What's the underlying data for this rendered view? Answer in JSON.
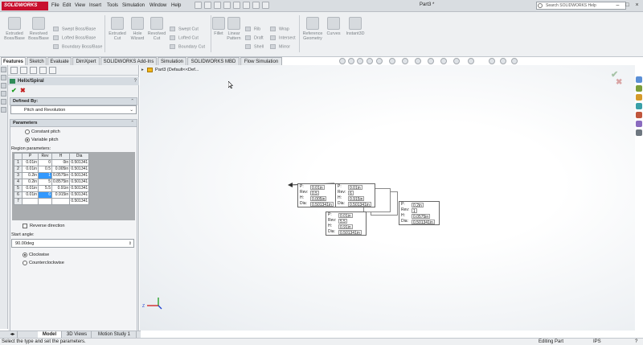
{
  "app": {
    "logo": "SOLIDWORKS",
    "document_title": "Part3 *",
    "help_search_placeholder": "Search SOLIDWORKS Help"
  },
  "menus": [
    "File",
    "Edit",
    "View",
    "Insert",
    "Tools",
    "Simulation",
    "Window",
    "Help"
  ],
  "ribbon": {
    "extruded_boss": "Extruded Boss/Base",
    "revolved_boss": "Revolved Boss/Base",
    "swept_boss": "Swept Boss/Base",
    "lofted_boss": "Lofted Boss/Base",
    "boundary_boss": "Boundary Boss/Base",
    "extruded_cut": "Extruded Cut",
    "hole_wizard": "Hole Wizard",
    "revolved_cut": "Revolved Cut",
    "swept_cut": "Swept Cut",
    "lofted_cut": "Lofted Cut",
    "boundary_cut": "Boundary Cut",
    "fillet": "Fillet",
    "linear_pattern": "Linear Pattern",
    "rib": "Rib",
    "draft": "Draft",
    "shell": "Shell",
    "wrap": "Wrap",
    "intersect": "Intersect",
    "mirror": "Mirror",
    "reference_geometry": "Reference Geometry",
    "curves": "Curves",
    "instant3d": "Instant3D"
  },
  "command_tabs": [
    "Features",
    "Sketch",
    "Evaluate",
    "DimXpert",
    "SOLIDWORKS Add-Ins",
    "Simulation",
    "SOLIDWORKS MBD",
    "Flow Simulation"
  ],
  "property_manager": {
    "title": "Helix/Spiral",
    "help_icon": "?",
    "defined_by": {
      "header": "Defined By:",
      "selected": "Pitch and Revolution"
    },
    "parameters": {
      "header": "Parameters",
      "constant_pitch": "Constant pitch",
      "variable_pitch": "Variable pitch",
      "variable_pitch_selected": true,
      "region_label": "Region parameters:",
      "columns": [
        "P",
        "Rev",
        "H",
        "Dia"
      ],
      "rows": [
        {
          "n": "1",
          "p": "0.01in",
          "rev": "0",
          "h": "0in",
          "dia": "0.501341"
        },
        {
          "n": "2",
          "p": "0.01in",
          "rev": "0.5",
          "h": "0.005in",
          "dia": "0.501341"
        },
        {
          "n": "3",
          "p": "0.2in",
          "rev": "1",
          "h": "0.0575in",
          "dia": "0.501341"
        },
        {
          "n": "4",
          "p": "0.2in",
          "rev": "5",
          "h": "0.8575in",
          "dia": "0.501341"
        },
        {
          "n": "5",
          "p": "0.01in",
          "rev": "5.5",
          "h": "0.91in",
          "dia": "0.501341"
        },
        {
          "n": "6",
          "p": "0.01in",
          "rev": "6",
          "h": "0.915in",
          "dia": "0.501341"
        },
        {
          "n": "7",
          "p": "",
          "rev": "",
          "h": "",
          "dia": "0.501341"
        }
      ],
      "reverse_direction": "Reverse direction",
      "start_angle_label": "Start angle:",
      "start_angle_value": "90.00deg",
      "clockwise": "Clockwise",
      "counterclockwise": "Counterclockwise",
      "clockwise_selected": true
    }
  },
  "tree": {
    "root": "Part3  (Default<<Def..."
  },
  "callouts": [
    {
      "p": "0.01in",
      "rev": "0.5",
      "h": "0.005in",
      "dia": "0.501341in"
    },
    {
      "p": "0.01in",
      "rev": "6",
      "h": "0.915in",
      "dia": "0.501341in"
    },
    {
      "p": "0.2in",
      "rev": "1",
      "h": "0.0575in",
      "dia": "0.501341in"
    },
    {
      "p": "0.01in",
      "rev": "5.5",
      "h": "0.91in",
      "dia": "0.501341in"
    }
  ],
  "callout_labels": {
    "p": "P:",
    "rev": "Rev:",
    "h": "H:",
    "dia": "Dia:"
  },
  "bottom_tabs": [
    "Model",
    "3D Views",
    "Motion Study 1"
  ],
  "status": {
    "message": "Select the type and set the parameters.",
    "mode": "Editing Part",
    "units": "IPS"
  }
}
